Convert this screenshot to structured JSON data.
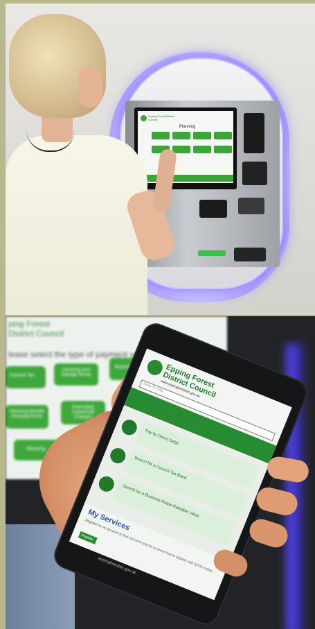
{
  "kiosk": {
    "logo_text": "Epping Forest District Council",
    "heading": "Planning"
  },
  "phone": {
    "logo_line1": "Epping Forest",
    "logo_line2": "District Council",
    "website": "www.eppingforestdc.gov.uk",
    "search_placeholder": "Search Site",
    "items": [
      {
        "label": "Pay by Direct Debit"
      },
      {
        "label": "Search for a Council Tax Band"
      },
      {
        "label": "Search for a Business Rates Rateable Value"
      }
    ],
    "services_title": "My Services",
    "services_text": "Register for an account to find out more and let us know how to register with EFDC online",
    "register_button": "Register",
    "address_bar": "eppingforestdc.gov.uk"
  },
  "background_kiosk": {
    "logo_line1": "ping Forest",
    "logo_line2": "District Council",
    "prompt": "lease select the type of payment you wish to make",
    "tiles": [
      "Council Tax",
      "Housing and Garage Rents",
      "Business Rates",
      "Housing Benefit Overpayments",
      "Estimated Leasehold Charges",
      "Planning"
    ]
  },
  "colors": {
    "brand_green": "#3ea33a",
    "dark_green": "#1f7a2a",
    "kiosk_glow": "#8b7cff"
  }
}
